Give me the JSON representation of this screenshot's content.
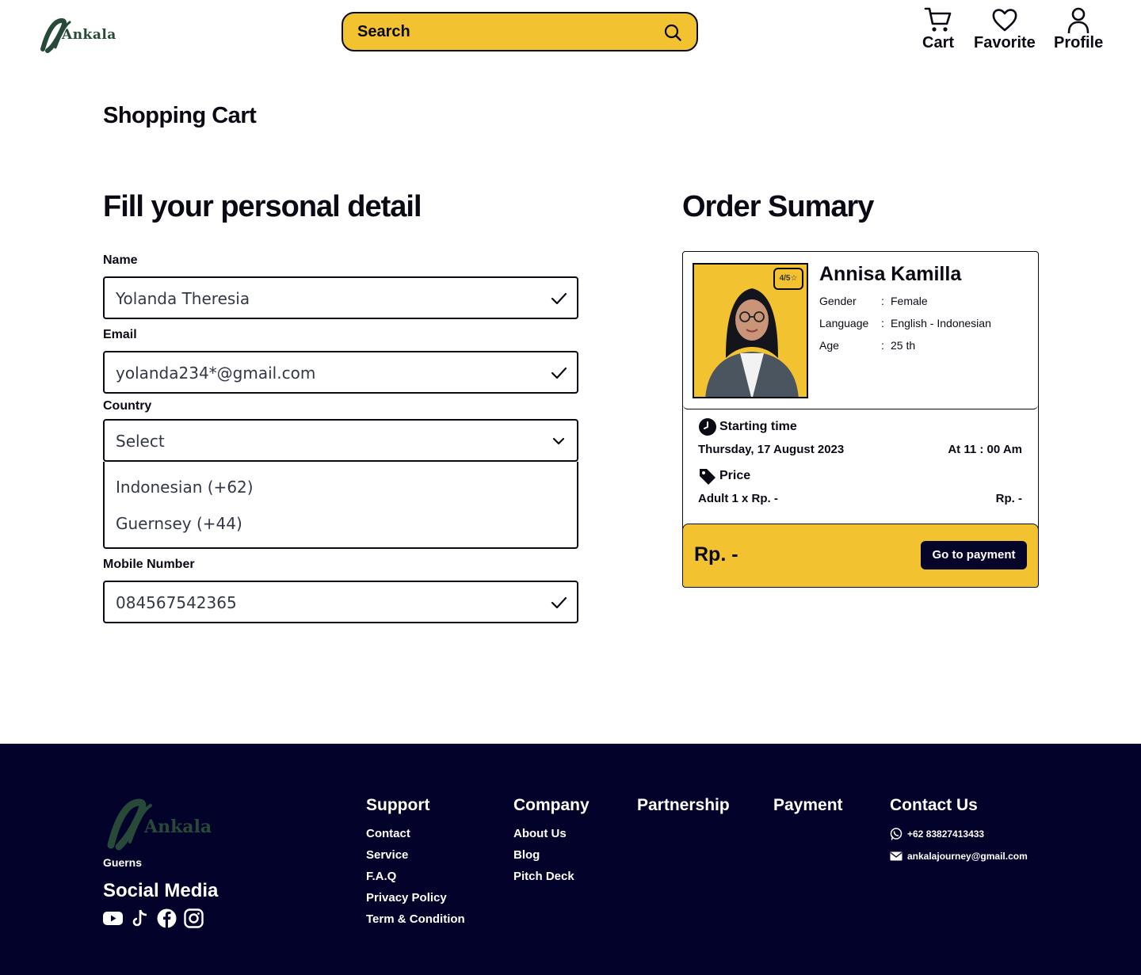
{
  "header": {
    "logo_text": "Ankala",
    "search_placeholder": "Search",
    "nav": {
      "cart": "Cart",
      "favorite": "Favorite",
      "profile": "Profile"
    }
  },
  "page_title": "Shopping Cart",
  "form": {
    "title": "Fill your personal detail",
    "name_label": "Name",
    "name_value": "Yolanda Theresia",
    "email_label": "Email",
    "email_value": "yolanda234*@gmail.com",
    "country_label": "Country",
    "country_value": "Select",
    "country_options": [
      "Indonesian (+62)",
      "Guernsey (+44)"
    ],
    "mobile_label": "Mobile Number",
    "mobile_value": "084567542365"
  },
  "summary": {
    "title": "Order Sumary",
    "rating": "4/5",
    "host_name": "Annisa Kamilla",
    "gender_label": "Gender",
    "gender_value": "Female",
    "language_label": "Language",
    "language_value": "English - Indonesian",
    "age_label": "Age",
    "age_value": "25 th",
    "starting_label": "Starting time",
    "date": "Thursday, 17 August 2023",
    "time": "At 11 : 00 Am",
    "price_label": "Price",
    "adult_line": "Adult 1 x Rp. -",
    "adult_price": "Rp. -",
    "total": "Rp. -",
    "pay_button": "Go to payment"
  },
  "footer": {
    "logo_text": "Ankala",
    "small_text": "Guerns",
    "social_title": "Social Media",
    "support_title": "Support",
    "support_links": [
      "Contact",
      "Service",
      "F.A.Q",
      "Privacy Policy",
      "Term & Condition"
    ],
    "company_title": "Company",
    "company_links": [
      "About Us",
      "Blog",
      "Pitch Deck"
    ],
    "partnership_title": "Partnership",
    "payment_title": "Payment",
    "contact_title": "Contact Us",
    "phone": "+62 83827413433",
    "email": "ankalajourney@gmail.com"
  },
  "colors": {
    "accent": "#f2c230",
    "dark": "#02022a",
    "brand_green": "#274a38"
  }
}
